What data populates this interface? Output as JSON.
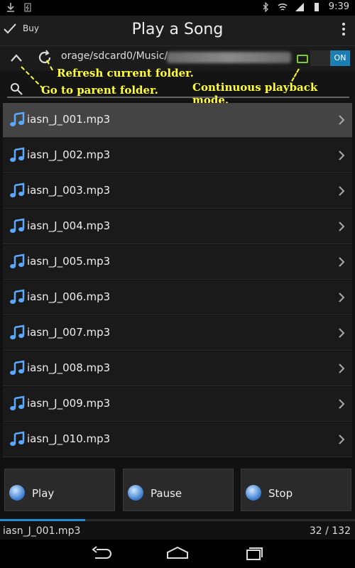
{
  "statusbar": {
    "time": "9:39"
  },
  "actionbar": {
    "buy_label": "Buy",
    "title": "Play a Song"
  },
  "pathbar": {
    "path_text": "orage/sdcard0/Music/",
    "toggle_label": "ON"
  },
  "annotations": {
    "refresh": "Refresh current folder.",
    "parent": "Go to parent folder.",
    "continuous": "Continuous playback mode."
  },
  "files": [
    {
      "name": "iasn_J_001.mp3"
    },
    {
      "name": "iasn_J_002.mp3"
    },
    {
      "name": "iasn_J_003.mp3"
    },
    {
      "name": "iasn_J_004.mp3"
    },
    {
      "name": "iasn_J_005.mp3"
    },
    {
      "name": "iasn_J_006.mp3"
    },
    {
      "name": "iasn_J_007.mp3"
    },
    {
      "name": "iasn_J_008.mp3"
    },
    {
      "name": "iasn_J_009.mp3"
    },
    {
      "name": "iasn_J_010.mp3"
    }
  ],
  "controls": {
    "play_label": "Play",
    "pause_label": "Pause",
    "stop_label": "Stop"
  },
  "nowplaying": {
    "title": "iasn_J_001.mp3",
    "counter": "32 / 132",
    "progress": 0.24
  },
  "colors": {
    "accent": "#1b7fb3",
    "annotation": "#ffff33",
    "selected_row": "#444444"
  },
  "icons": {
    "up": "chevron-up-icon",
    "refresh": "refresh-icon",
    "search": "search-icon",
    "note": "music-note-icon",
    "chevron": "chevron-right-icon",
    "back": "back-icon",
    "home": "home-icon",
    "recents": "recents-icon"
  }
}
